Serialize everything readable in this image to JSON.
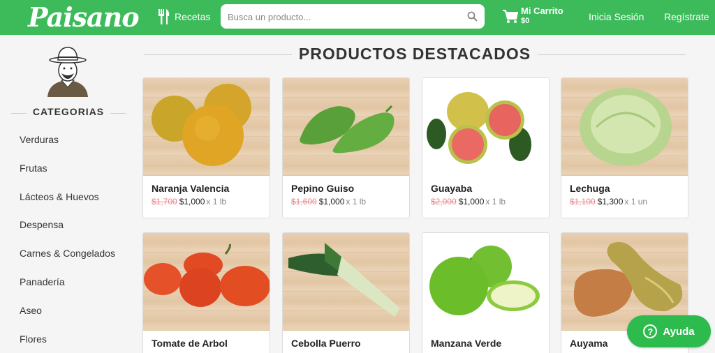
{
  "header": {
    "logo": "Paisano",
    "recipes_label": "Recetas",
    "search_placeholder": "Busca un producto...",
    "cart_label": "Mi Carrito",
    "cart_value": "$0",
    "login_label": "Inicia Sesión",
    "register_label": "Regístrate"
  },
  "sidebar": {
    "title": "CATEGORIAS",
    "items": [
      {
        "label": "Verduras"
      },
      {
        "label": "Frutas"
      },
      {
        "label": "Lácteos & Huevos"
      },
      {
        "label": "Despensa"
      },
      {
        "label": "Carnes & Congelados"
      },
      {
        "label": "Panadería"
      },
      {
        "label": "Aseo"
      },
      {
        "label": "Flores"
      }
    ]
  },
  "main": {
    "title": "PRODUCTOS DESTACADOS",
    "products": [
      {
        "name": "Naranja Valencia",
        "old_price": "$1,700",
        "price": "$1,000",
        "unit": "x 1 lb",
        "icon": "orange-icon"
      },
      {
        "name": "Pepino Guiso",
        "old_price": "$1,600",
        "price": "$1,000",
        "unit": "x 1 lb",
        "icon": "cucumber-icon"
      },
      {
        "name": "Guayaba",
        "old_price": "$2,000",
        "price": "$1,000",
        "unit": "x 1 lb",
        "icon": "guava-icon"
      },
      {
        "name": "Lechuga",
        "old_price": "$1,100",
        "price": "$1,300",
        "unit": "x 1 un",
        "icon": "lettuce-icon"
      },
      {
        "name": "Tomate de Arbol",
        "icon": "tree-tomato-icon"
      },
      {
        "name": "Cebolla Puerro",
        "icon": "leek-icon"
      },
      {
        "name": "Manzana Verde",
        "icon": "green-apple-icon"
      },
      {
        "name": "Auyama",
        "icon": "squash-icon"
      }
    ]
  },
  "help": {
    "label": "Ayuda"
  },
  "colors": {
    "brand_green": "#3dbb5b",
    "old_price": "#e8868a"
  }
}
